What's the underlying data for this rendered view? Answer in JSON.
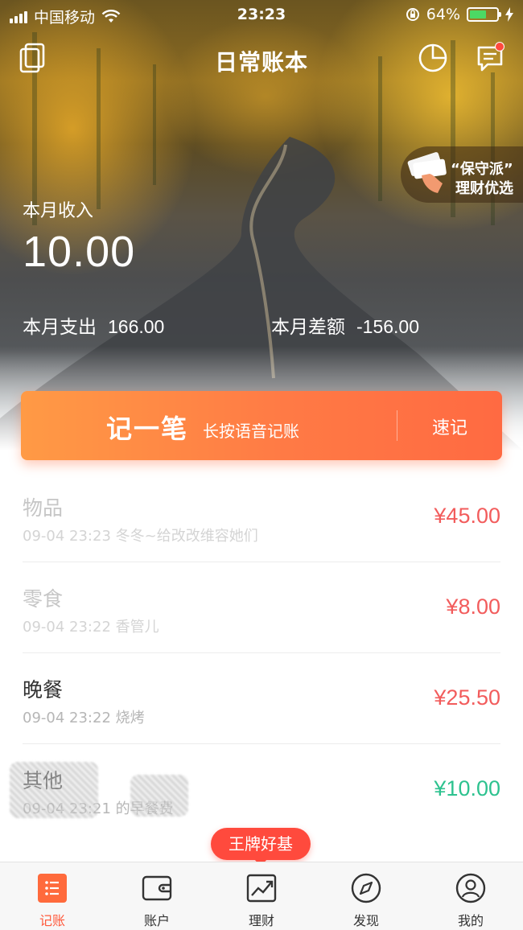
{
  "status_bar": {
    "carrier": "中国移动",
    "time": "23:23",
    "battery": "64%"
  },
  "nav": {
    "title": "日常账本",
    "icons": [
      "book-copy-icon",
      "pie-chart-icon",
      "message-icon"
    ]
  },
  "promo": {
    "line1": "“保守派”",
    "line2": "理财优选"
  },
  "summary": {
    "income_label": "本月收入",
    "income_value": "10.00",
    "expense_label": "本月支出",
    "expense_value": "166.00",
    "balance_label": "本月差额",
    "balance_value": "-156.00"
  },
  "record_button": {
    "main": "记一笔",
    "hint": "长按语音记账",
    "quick": "速记"
  },
  "transactions": [
    {
      "category": "物品",
      "note": "09-04 23:23  冬冬~给改改维容她们",
      "amount": "¥45.00",
      "type": "expense"
    },
    {
      "category": "零食",
      "note": "09-04 23:22  香管儿",
      "amount": "¥8.00",
      "type": "expense"
    },
    {
      "category": "晚餐",
      "note": "09-04 23:22  烧烤",
      "amount": "¥25.50",
      "type": "expense"
    },
    {
      "category": "其他",
      "note": "09-04 23:21  的早餐费",
      "amount": "¥10.00",
      "type": "income"
    }
  ],
  "floating_tag": "王牌好基",
  "tabs": [
    {
      "label": "记账",
      "icon": "ledger-icon",
      "active": true
    },
    {
      "label": "账户",
      "icon": "wallet-icon",
      "active": false
    },
    {
      "label": "理财",
      "icon": "trend-chart-icon",
      "active": false
    },
    {
      "label": "发现",
      "icon": "compass-icon",
      "active": false
    },
    {
      "label": "我的",
      "icon": "user-icon",
      "active": false
    }
  ],
  "colors": {
    "accent": "#ff6a42",
    "expense": "#f25c5c",
    "income": "#2dc28f",
    "tab_active": "#ff5a3c"
  }
}
